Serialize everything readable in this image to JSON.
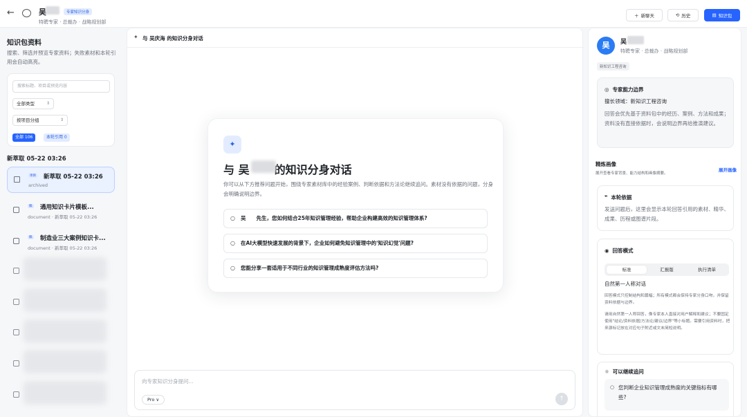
{
  "topbar": {
    "back_icon": "arrow-left-icon",
    "name": "吴",
    "badge": "专家知识分身",
    "subtitle": "特聘专家 · 总裁办 · 战略规划部",
    "new_chat": "新聊天",
    "history": "历史",
    "knowledge_pack": "知识包",
    "accent": "#2663ff"
  },
  "left": {
    "title": "知识包资料",
    "desc": "搜索、筛选并预览专家资料；失败素材和本轮引用会自动高亮。",
    "search_placeholder": "搜索标题、项目或预览内容",
    "type_select": "全部类型",
    "group_select": "按项目分组",
    "pill_all": "全部 106",
    "pill_cited": "本轮引用 0",
    "group_title": "新萃取 05-22 03:26",
    "items": [
      {
        "tag": "项目",
        "title": "新萃取 05-22 03:26",
        "meta": "archived"
      },
      {
        "tag": "稿",
        "title": "通用知识卡片模板...",
        "meta": "document · 新萃取 05-22 03:26"
      },
      {
        "tag": "稿",
        "title": "制造业三大案例知识卡...",
        "meta": "document · 新萃取 05-22 03:26"
      }
    ]
  },
  "center": {
    "header": "与 吴庆海 的知识分身对话",
    "welcome_title_prefix": "与 吴",
    "welcome_title_suffix": "的知识分身对话",
    "intro": "你可以从下方推荐问题开始，围绕专家素材库中的经验案例、判断依据和方法论继续追问。素材没有依据的问题，分身会明确说明边界。",
    "questions": [
      "吴　　先生，您如何结合25年知识管理经验，帮助企业构建高效的知识管理体系?",
      "在AI大模型快速发展的背景下，企业如何避免知识管理中的'知识幻觉'问题?",
      "您能分享一套适用于不同行业的知识管理成熟度评估方法吗?"
    ],
    "composer_placeholder": "向专家知识分身提问...",
    "mode": "Pro ∨"
  },
  "right": {
    "avatar": "吴",
    "name": "吴",
    "subtitle": "特聘专家 · 总裁办 · 战略规划部",
    "tag": "新知识工程咨询",
    "ability": {
      "title": "专家能力边界",
      "field": "擅长领域：新知识工程咨询",
      "body": "回答会优先基于资料包中的经历、案例、方法和成果；资料没有直接依据时，会说明边界再给推演建议。"
    },
    "profile": {
      "title": "精炼画像",
      "desc": "展开查看专家背景、能力结构和画像摘要。",
      "link": "展开画像"
    },
    "basis": {
      "title": "本轮依据",
      "body": "发送问题后，这里会显示本轮回答引用的素材、精华、成果、历程或图谱片段。"
    },
    "mode": {
      "title": "回答模式",
      "tabs": [
        "标准",
        "汇报版",
        "执行清单"
      ],
      "heading": "自然第一人称对话",
      "note1": "回答模式只控制结构和篇幅；所有模式都会保持专家分身口吻，并保留资料依据与边界。",
      "note2": "请用自然第一人称回答，像专家本人直接对用户解释和建议；不要固定使用\"结论/资料依据/方法论/建议/边界\"等小标题。需要引用资料时，把来源标记放在对应句子附近或文末简短说明。"
    },
    "follow": {
      "title": "可以继续追问",
      "item": "您判断企业知识管理成熟度的关键指标有哪些?"
    }
  }
}
